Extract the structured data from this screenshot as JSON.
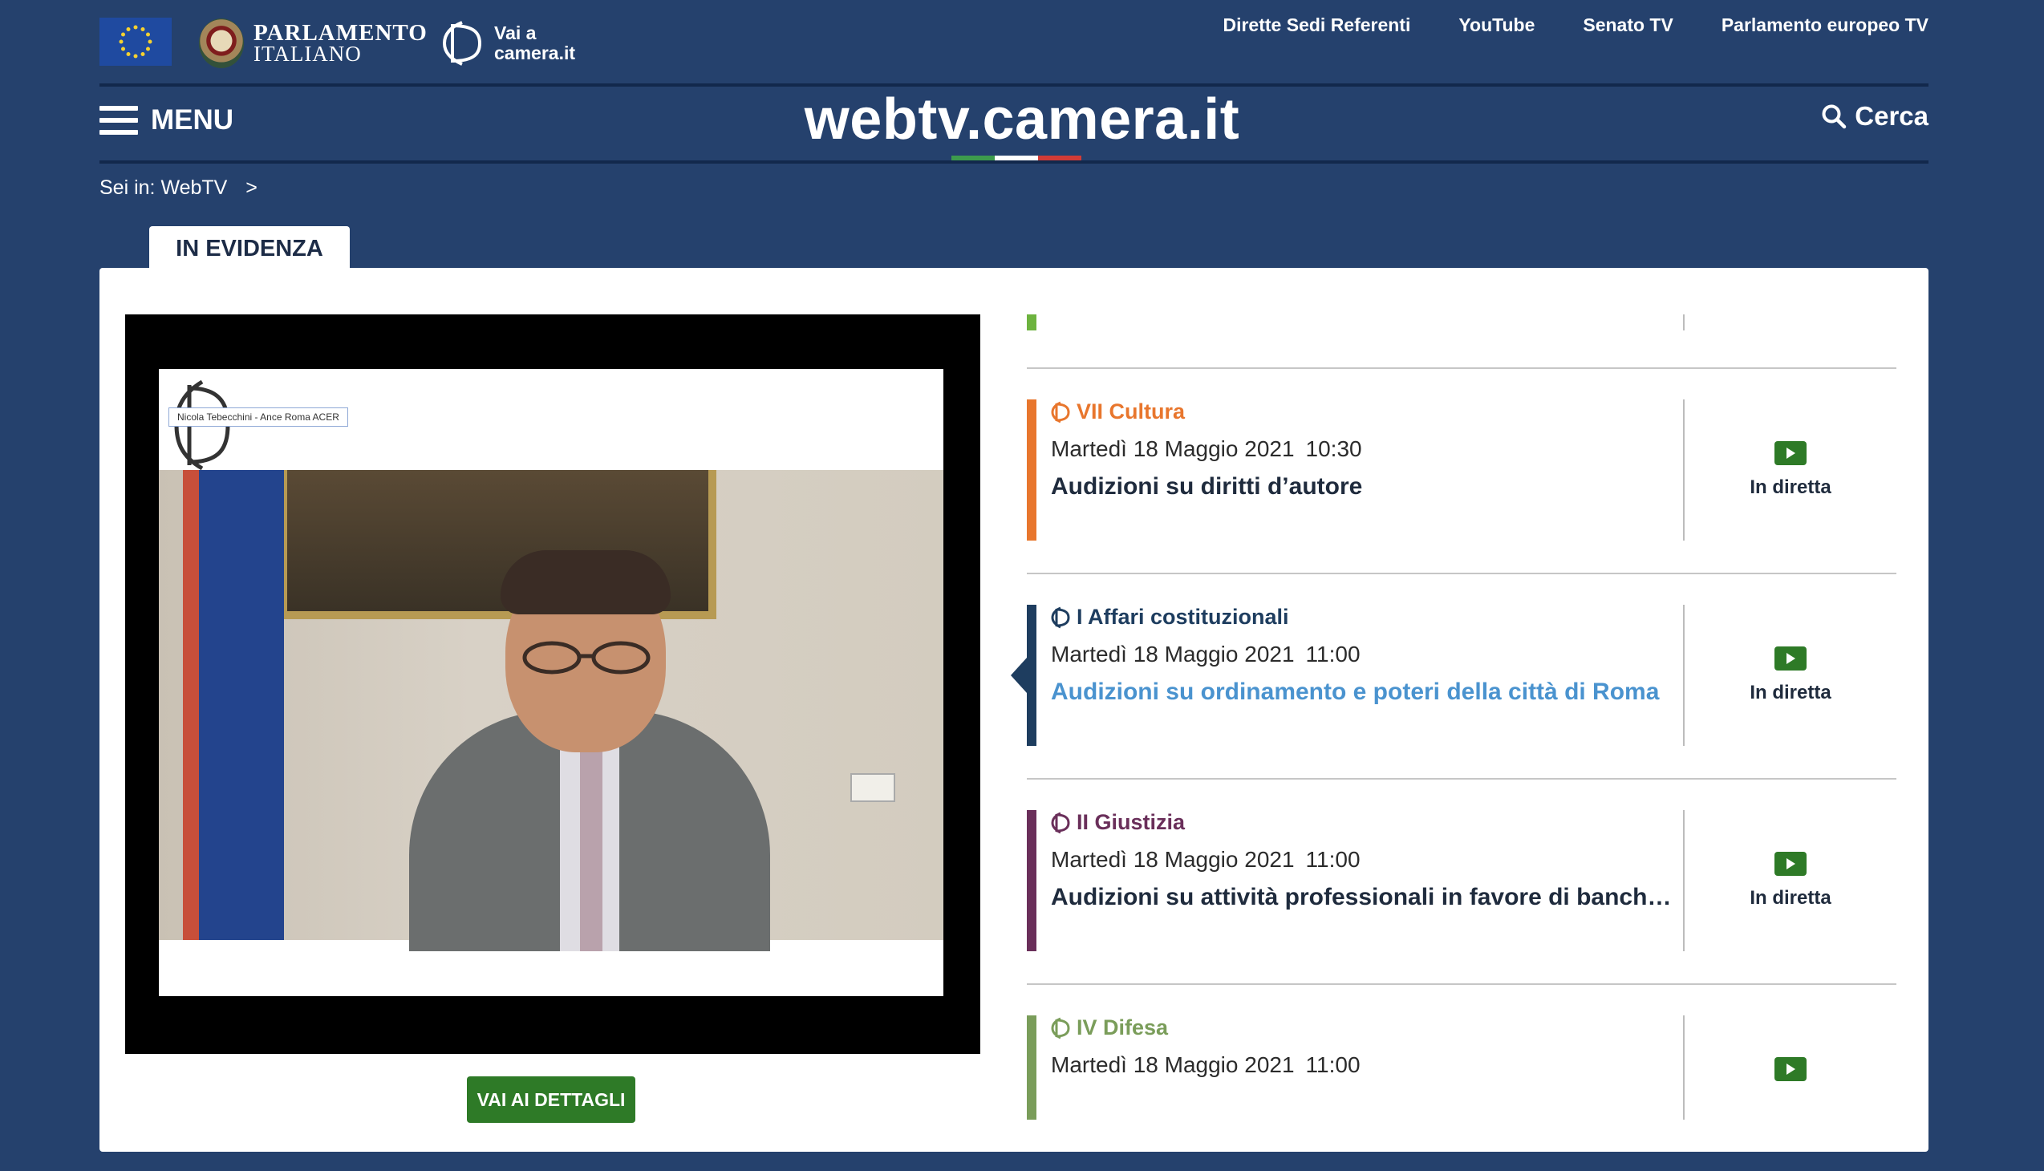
{
  "top_links": [
    "Dirette Sedi Referenti",
    "YouTube",
    "Senato TV",
    "Parlamento europeo TV"
  ],
  "parlamento": {
    "line1": "PARLAMENTO",
    "line2": "ITALIANO"
  },
  "camera_link": {
    "line1": "Vai a",
    "line2": "camera.it"
  },
  "header": {
    "menu_label": "MENU",
    "site_title": "webtv.camera.it",
    "search_label": "Cerca"
  },
  "breadcrumb": {
    "prefix": "Sei in:",
    "current": "WebTV",
    "separator": ">"
  },
  "tab_label": "IN EVIDENZA",
  "video": {
    "name_tag": "Nicola Tebecchini - Ance Roma ACER"
  },
  "details_button": "VAI AI DETTAGLI",
  "colors": {
    "background": "#25416d",
    "cultura": "#e8762d",
    "affari": "#1e3d5f",
    "giustizia": "#6a2f5a",
    "difesa": "#7a9d5a",
    "live_green": "#2e7a27",
    "active_link": "#4a93cf"
  },
  "schedule": [
    {
      "commission": "VII Cultura",
      "date": "Martedì 18 Maggio 2021",
      "time": "10:30",
      "title": "Audizioni su diritti d’autore",
      "status": "In diretta"
    },
    {
      "commission": "I Affari costituzionali",
      "date": "Martedì 18 Maggio 2021",
      "time": "11:00",
      "title": "Audizioni su ordinamento e poteri della città di Roma",
      "status": "In diretta"
    },
    {
      "commission": "II Giustizia",
      "date": "Martedì 18 Maggio 2021",
      "time": "11:00",
      "title": "Audizioni su attività professionali in favore di banche e a...",
      "status": "In diretta"
    },
    {
      "commission": "IV Difesa",
      "date": "Martedì 18 Maggio 2021",
      "time": "11:00",
      "title": "",
      "status": ""
    }
  ]
}
